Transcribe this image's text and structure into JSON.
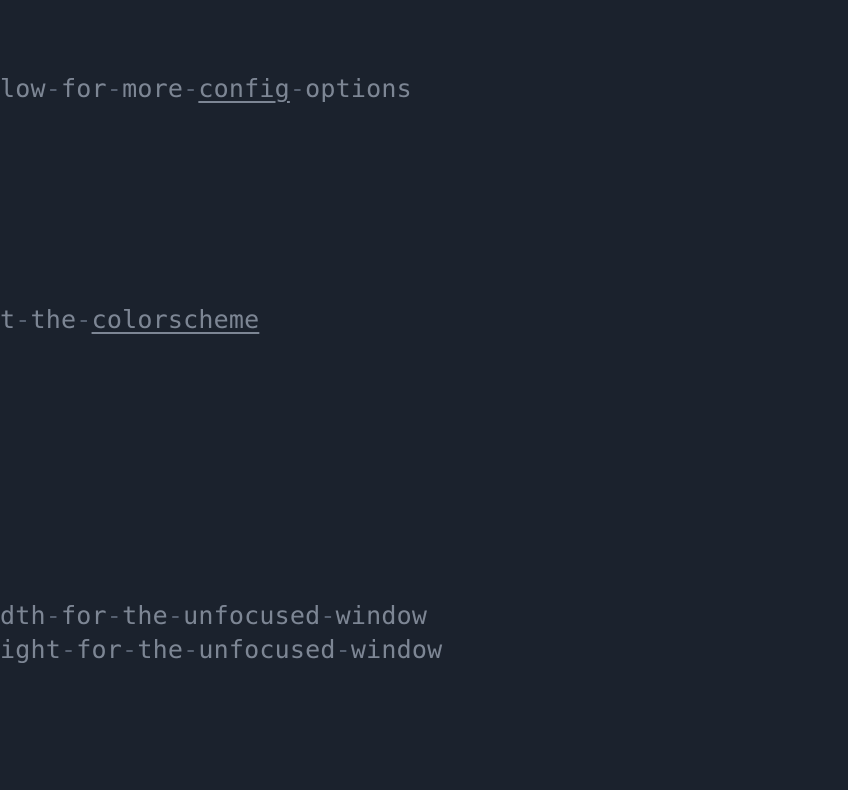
{
  "editor": {
    "background": "#1b222d",
    "text_color": "#7d8694",
    "separator_color": "#566070",
    "lines": [
      {
        "segments": [
          {
            "text": "low",
            "kind": "word"
          },
          {
            "text": "-",
            "kind": "sep"
          },
          {
            "text": "for",
            "kind": "word"
          },
          {
            "text": "-",
            "kind": "sep"
          },
          {
            "text": "more",
            "kind": "word"
          },
          {
            "text": "-",
            "kind": "sep"
          },
          {
            "text": "config",
            "kind": "link"
          },
          {
            "text": "-",
            "kind": "sep"
          },
          {
            "text": "options",
            "kind": "word"
          }
        ]
      },
      {
        "segments": [
          {
            "text": "t",
            "kind": "word"
          },
          {
            "text": "-",
            "kind": "sep"
          },
          {
            "text": "the",
            "kind": "word"
          },
          {
            "text": "-",
            "kind": "sep"
          },
          {
            "text": "colorscheme",
            "kind": "link"
          }
        ]
      },
      {
        "segments": [
          {
            "text": "dth",
            "kind": "word"
          },
          {
            "text": "-",
            "kind": "sep"
          },
          {
            "text": "for",
            "kind": "word"
          },
          {
            "text": "-",
            "kind": "sep"
          },
          {
            "text": "the",
            "kind": "word"
          },
          {
            "text": "-",
            "kind": "sep"
          },
          {
            "text": "unfocused",
            "kind": "word"
          },
          {
            "text": "-",
            "kind": "sep"
          },
          {
            "text": "window",
            "kind": "word"
          }
        ]
      },
      {
        "segments": [
          {
            "text": "ight",
            "kind": "word"
          },
          {
            "text": "-",
            "kind": "sep"
          },
          {
            "text": "for",
            "kind": "word"
          },
          {
            "text": "-",
            "kind": "sep"
          },
          {
            "text": "the",
            "kind": "word"
          },
          {
            "text": "-",
            "kind": "sep"
          },
          {
            "text": "unfocused",
            "kind": "word"
          },
          {
            "text": "-",
            "kind": "sep"
          },
          {
            "text": "window",
            "kind": "word"
          }
        ]
      }
    ]
  }
}
